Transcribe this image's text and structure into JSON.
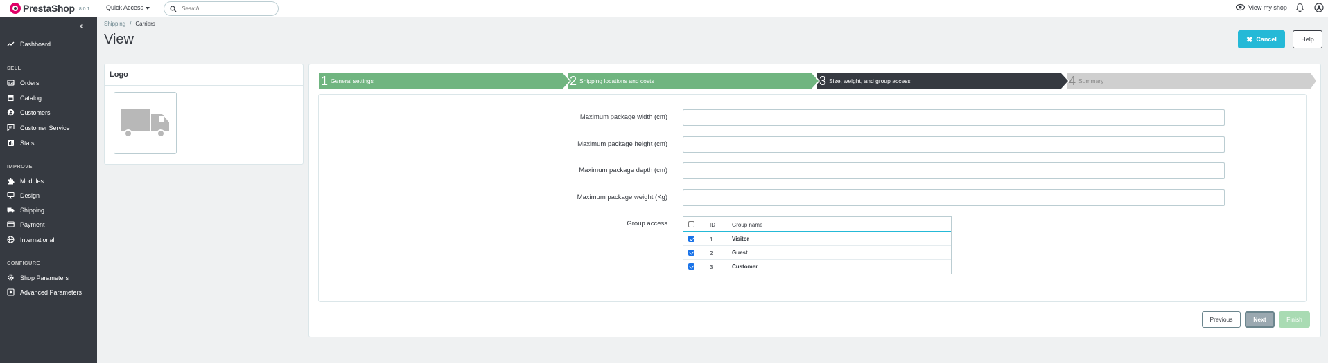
{
  "header": {
    "brand": "PrestaShop",
    "version": "8.0.1",
    "quick_access": "Quick Access",
    "search_placeholder": "Search",
    "view_my_shop": "View my shop"
  },
  "sidebar": {
    "dashboard": "Dashboard",
    "sections": {
      "sell": "SELL",
      "improve": "IMPROVE",
      "configure": "CONFIGURE"
    },
    "sell_items": [
      "Orders",
      "Catalog",
      "Customers",
      "Customer Service",
      "Stats"
    ],
    "improve_items": [
      "Modules",
      "Design",
      "Shipping",
      "Payment",
      "International"
    ],
    "configure_items": [
      "Shop Parameters",
      "Advanced Parameters"
    ]
  },
  "breadcrumb": {
    "parent": "Shipping",
    "separator": "/",
    "current": "Carriers"
  },
  "page_title": "View",
  "toolbar": {
    "cancel": "Cancel",
    "help": "Help"
  },
  "logo_panel": {
    "title": "Logo"
  },
  "wizard": {
    "steps": [
      {
        "num": "1",
        "label": "General settings",
        "state": "done"
      },
      {
        "num": "2",
        "label": "Shipping locations and costs",
        "state": "done"
      },
      {
        "num": "3",
        "label": "Size, weight, and group access",
        "state": "active"
      },
      {
        "num": "4",
        "label": "Summary",
        "state": "todo"
      }
    ],
    "colors": {
      "done": "#70b580",
      "active": "#363a41",
      "todo": "#cfcfcf",
      "accent": "#25b9d7"
    }
  },
  "form": {
    "width_label": "Maximum package width (cm)",
    "height_label": "Maximum package height (cm)",
    "depth_label": "Maximum package depth (cm)",
    "weight_label": "Maximum package weight (Kg)",
    "width_value": "",
    "height_value": "",
    "depth_value": "",
    "weight_value": "",
    "group_access_label": "Group access",
    "group_table": {
      "headers": {
        "id": "ID",
        "name": "Group name"
      },
      "rows": [
        {
          "id": "1",
          "name": "Visitor",
          "checked": true
        },
        {
          "id": "2",
          "name": "Guest",
          "checked": true
        },
        {
          "id": "3",
          "name": "Customer",
          "checked": true
        }
      ]
    }
  },
  "footer_buttons": {
    "previous": "Previous",
    "next": "Next",
    "finish": "Finish"
  }
}
